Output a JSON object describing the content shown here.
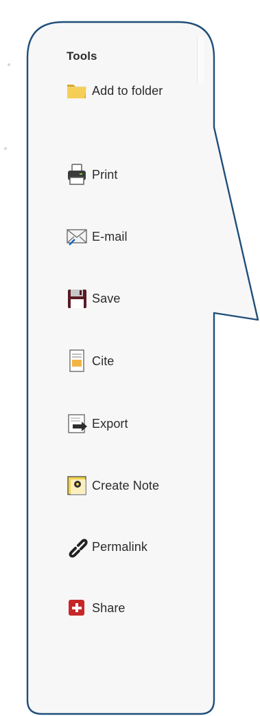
{
  "panel": {
    "title": "Tools",
    "items": [
      {
        "label": "Add to folder",
        "icon": "folder-icon"
      },
      {
        "label": "Print",
        "icon": "printer-icon"
      },
      {
        "label": "E-mail",
        "icon": "email-icon"
      },
      {
        "label": "Save",
        "icon": "save-icon"
      },
      {
        "label": "Cite",
        "icon": "cite-icon"
      },
      {
        "label": "Export",
        "icon": "export-icon"
      },
      {
        "label": "Create Note",
        "icon": "note-icon"
      },
      {
        "label": "Permalink",
        "icon": "link-icon"
      },
      {
        "label": "Share",
        "icon": "share-icon"
      }
    ]
  },
  "colors": {
    "callout_border": "#1f4e79",
    "panel_background": "#f7f7f7",
    "text": "#2b2b2b",
    "share_red": "#c62828"
  }
}
